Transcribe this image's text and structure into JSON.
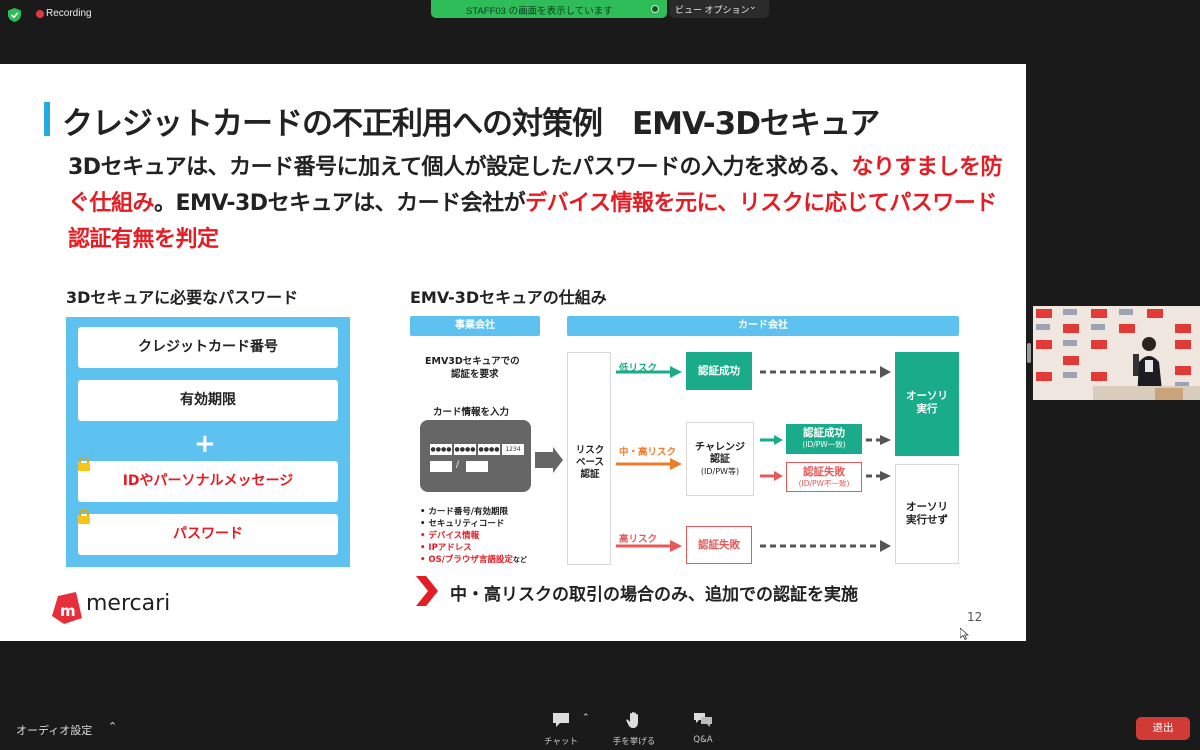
{
  "topbar": {
    "recording_label": "Recording",
    "share_banner_text": "STAFF03 の画面を表示しています",
    "view_options_label": "ビュー オプション"
  },
  "slide": {
    "title": "クレジットカードの不正利用への対策例　EMV-3Dセキュア",
    "lead_segments": [
      {
        "text": "3Dセキュアは、カード番号に加えて個人が設定したパスワードの入力を求める、",
        "highlight": false
      },
      {
        "text": "なりすましを防ぐ仕組み",
        "highlight": true
      },
      {
        "text": "。EMV-3Dセキュアは、カード会社が",
        "highlight": false
      },
      {
        "text": "デバイス情報を元に、リスクに応じてパスワード認証有無を判定",
        "highlight": true
      }
    ],
    "left_heading": "3Dセキュアに必要なパスワード",
    "fields": {
      "card_number": "クレジットカード番号",
      "expiry": "有効期限",
      "plus": "+",
      "personal_message": "IDやパーソナルメッセージ",
      "password": "パスワード"
    },
    "right_heading": "EMV-3Dセキュアの仕組み",
    "diagram": {
      "merchant_header": "事業会社",
      "card_company_header": "カード会社",
      "request_line1": "EMV3Dセキュアでの",
      "request_line2": "認証を要求",
      "card_input_label": "カード情報を入力",
      "card_digits": [
        "●●●●",
        "●●●●",
        "●●●●",
        "1234"
      ],
      "card_expiry_sep": "/",
      "info_items": [
        {
          "text": "カード番号/有効期限",
          "highlight": false
        },
        {
          "text": "セキュリティコード",
          "highlight": false
        },
        {
          "text": "デバイス情報",
          "highlight": true
        },
        {
          "text": "IPアドレス",
          "highlight": true
        },
        {
          "text": "OS/ブラウザ言語設定",
          "highlight": true,
          "suffix": "など"
        }
      ],
      "risk_based_line1": "リスク",
      "risk_based_line2": "ベース",
      "risk_based_line3": "認証",
      "low_risk": "低リスク",
      "mid_high_risk": "中・高リスク",
      "high_risk": "高リスク",
      "auth_success": "認証成功",
      "challenge_line1": "チャレンジ",
      "challenge_line2": "認証",
      "challenge_line3": "(ID/PW等)",
      "challenge_success": "認証成功",
      "challenge_success_sub": "(ID/PW一致)",
      "challenge_fail": "認証失敗",
      "challenge_fail_sub": "(ID/PW不一致)",
      "auth_fail": "認証失敗",
      "authorize_line1": "オーソリ",
      "authorize_line2": "実行",
      "no_authorize_line1": "オーソリ",
      "no_authorize_line2": "実行せず"
    },
    "bottom_note": "中・高リスクの取引の場合のみ、追加での認証を実施",
    "page_number": "12",
    "brand": "mercari"
  },
  "bottombar": {
    "audio_settings": "オーディオ設定",
    "chat": "チャット",
    "raise_hand": "手を挙げる",
    "qa": "Q&A",
    "leave": "退出"
  },
  "colors": {
    "accent_blue": "#27aae1",
    "highlight_red": "#e51c23",
    "green": "#1aab8a",
    "share_green": "#2ebd59",
    "leave_red": "#d13a35"
  }
}
